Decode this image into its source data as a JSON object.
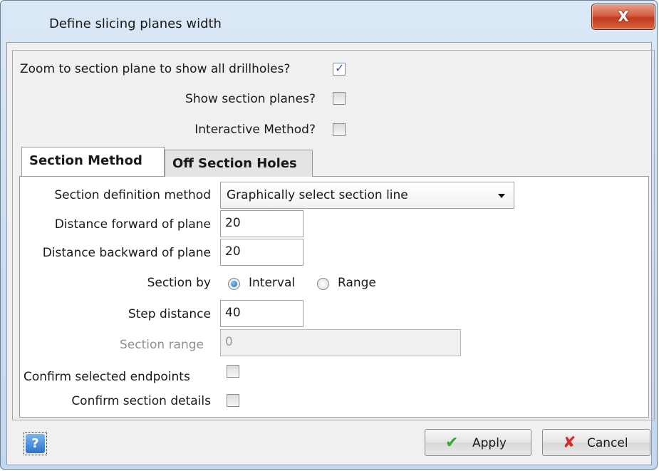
{
  "window": {
    "title": "Define slicing planes width",
    "close_glyph": "X"
  },
  "options": {
    "zoom_label": "Zoom to section plane to show all drillholes?",
    "zoom_checked": true,
    "show_planes_label": "Show section planes?",
    "show_planes_checked": false,
    "interactive_label": "Interactive Method?",
    "interactive_checked": false
  },
  "tabs": [
    {
      "label": "Section Method",
      "active": true
    },
    {
      "label": "Off Section Holes",
      "active": false
    }
  ],
  "section": {
    "method_label": "Section definition method",
    "method_value": "Graphically select section line",
    "forward_label": "Distance forward of plane",
    "forward_value": "20",
    "backward_label": "Distance backward of plane",
    "backward_value": "20",
    "section_by_label": "Section by",
    "interval_label": "Interval",
    "range_label": "Range",
    "section_by_selected": "Interval",
    "step_label": "Step distance",
    "step_value": "40",
    "range_field_label": "Section range",
    "range_field_value": "0",
    "confirm_endpoints_label": "Confirm selected endpoints",
    "confirm_endpoints_checked": false,
    "confirm_details_label": "Confirm section details",
    "confirm_details_checked": false
  },
  "footer": {
    "help_glyph": "?",
    "apply_label": "Apply",
    "cancel_label": "Cancel"
  },
  "icons": {
    "close": "close-icon",
    "help": "help-icon",
    "apply": "checkmark-icon",
    "cancel": "cross-icon",
    "dropdown": "chevron-down-icon"
  },
  "colors": {
    "titlebar": "#c9dcf1",
    "close_button": "#c94a2c",
    "apply_icon": "#3aa636",
    "cancel_icon": "#d92b2b",
    "radio_selected": "#1f6cb8"
  }
}
